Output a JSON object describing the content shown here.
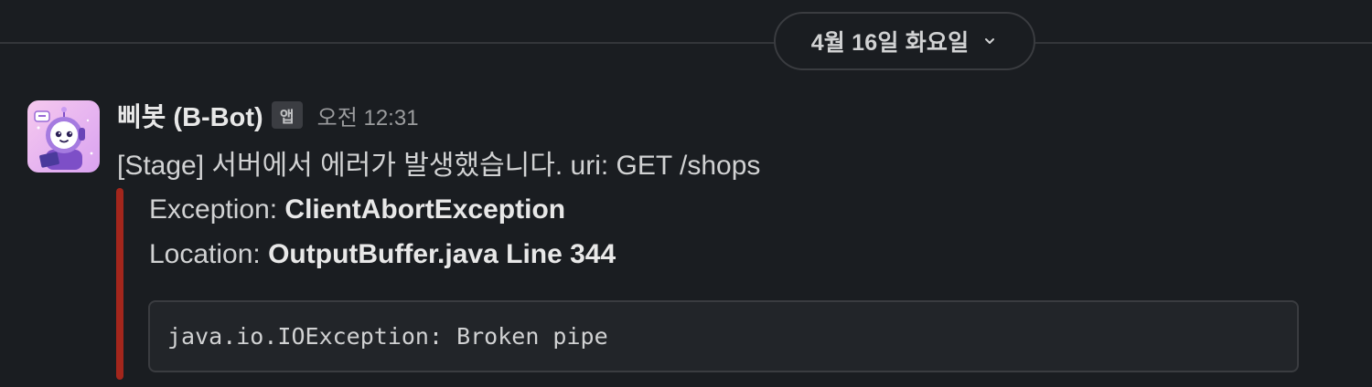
{
  "date_divider": {
    "label": "4월 16일 화요일",
    "icon": "chevron-down-icon"
  },
  "message": {
    "avatar_icon": "robot-avatar-icon",
    "sender": "삐봇 (B-Bot)",
    "badge": "앱",
    "timestamp": "오전 12:31",
    "text": "[Stage] 서버에서 에러가 발생했습니다. uri: GET /shops",
    "attachment": {
      "accent_color": "#a3261c",
      "fields": [
        {
          "label": "Exception: ",
          "value": "ClientAbortException"
        },
        {
          "label": "Location: ",
          "value": "OutputBuffer.java Line 344"
        }
      ],
      "code": "java.io.IOException: Broken pipe"
    }
  }
}
